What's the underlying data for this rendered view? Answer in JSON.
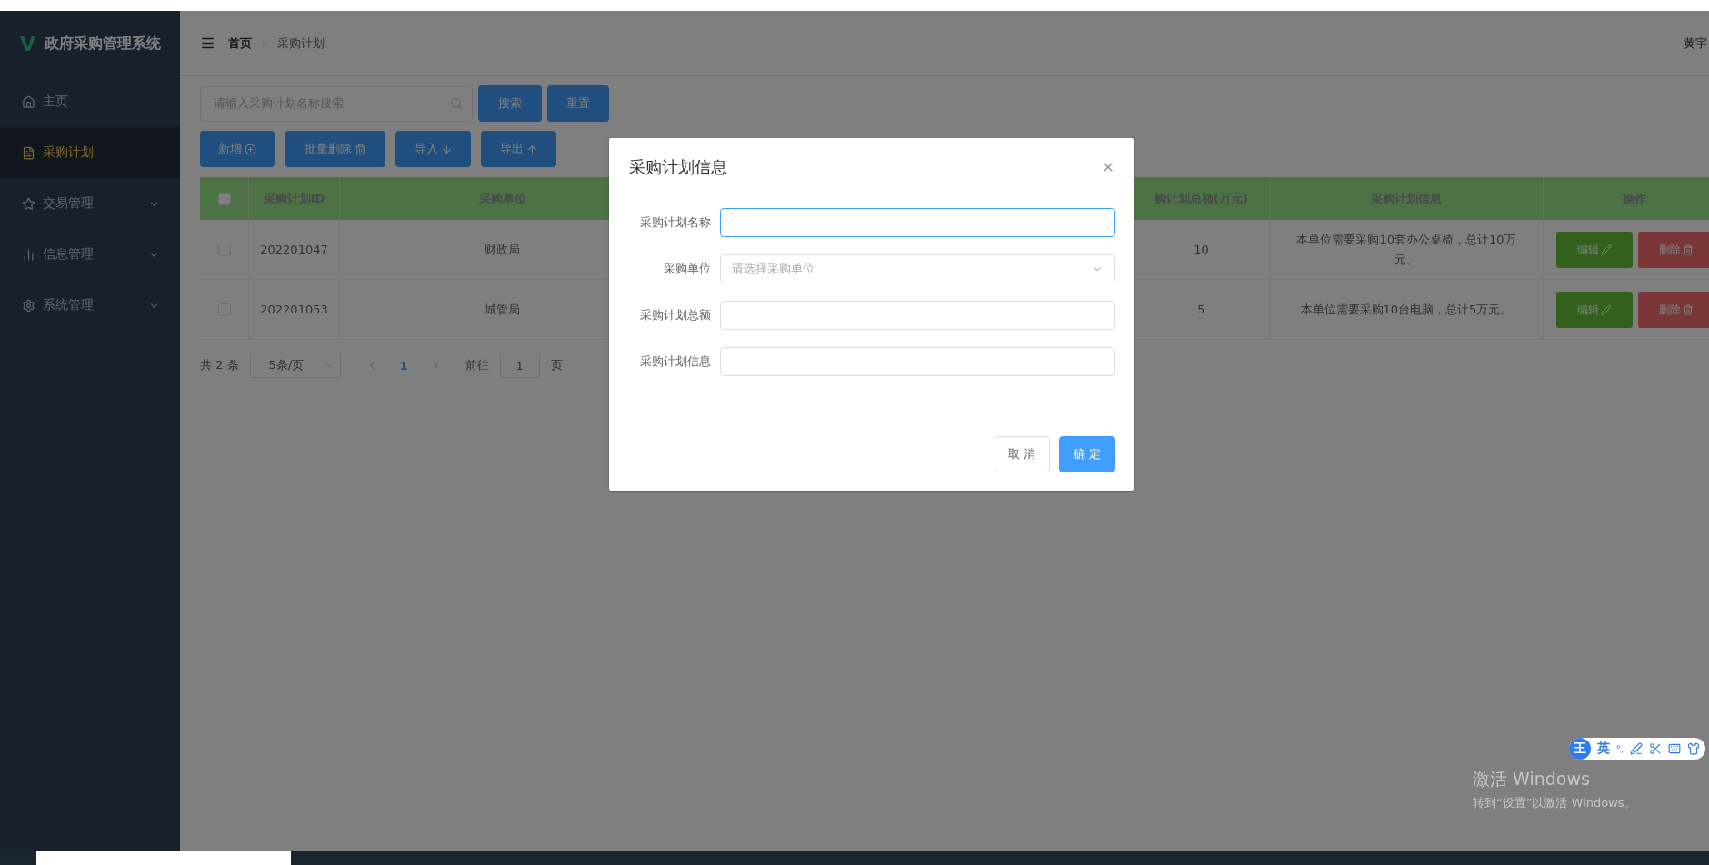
{
  "sidebar": {
    "logo_mark": "V",
    "title": "政府采购管理系统",
    "items": [
      {
        "label": "主页",
        "selected": false,
        "has_submenu": false
      },
      {
        "label": "采购计划",
        "selected": true,
        "has_submenu": false
      },
      {
        "label": "交易管理",
        "selected": false,
        "has_submenu": true
      },
      {
        "label": "信息管理",
        "selected": false,
        "has_submenu": true
      },
      {
        "label": "系统管理",
        "selected": false,
        "has_submenu": true
      }
    ]
  },
  "header": {
    "breadcrumb": [
      "首页",
      "采购计划"
    ],
    "user": "黄宇"
  },
  "search": {
    "placeholder": "请输入采购计划名称搜索",
    "buttons": [
      "搜索",
      "重置"
    ]
  },
  "actions": [
    "新增",
    "批量删除",
    "导入",
    "导出"
  ],
  "table": {
    "header_checked": false,
    "columns": [
      "采购计划ID",
      "采购单位",
      "购计划总额(万元)",
      "采购计划信息",
      "操作"
    ],
    "rows": [
      {
        "checked": false,
        "id": "202201047",
        "unit": "财政局",
        "total": "10",
        "info": "本单位需要采购10套办公桌椅，总计10万元。",
        "buttons": [
          "编辑",
          "删除"
        ]
      },
      {
        "checked": false,
        "id": "202201053",
        "unit": "城管局",
        "total": "5",
        "info": "本单位需要采购10台电脑，总计5万元。",
        "buttons": [
          "编辑",
          "删除"
        ]
      }
    ]
  },
  "pagination": {
    "total": "共 2 条",
    "page_size": "5条/页",
    "pages": [
      {
        "label": "1",
        "selected": true
      }
    ],
    "goto_label": "前往",
    "goto_value": "1",
    "goto_suffix": "页"
  },
  "dialog": {
    "title": "采购计划信息",
    "fields": [
      {
        "label": "采购计划名称",
        "kind": "input",
        "focused": true
      },
      {
        "label": "采购单位",
        "kind": "select",
        "placeholder": "请选择采购单位",
        "focused": false
      },
      {
        "label": "采购计划总额",
        "kind": "input",
        "focused": false
      },
      {
        "label": "采购计划信息",
        "kind": "input",
        "focused": false
      }
    ],
    "buttons": [
      {
        "label": "取 消",
        "kind": "default"
      },
      {
        "label": "确 定",
        "kind": "primary"
      }
    ]
  },
  "ime": {
    "logo": "王",
    "mode": "英",
    "punct": "°,"
  },
  "activation": {
    "title": "激活 Windows",
    "subtitle": "转到“设置”以激活 Windows。"
  }
}
